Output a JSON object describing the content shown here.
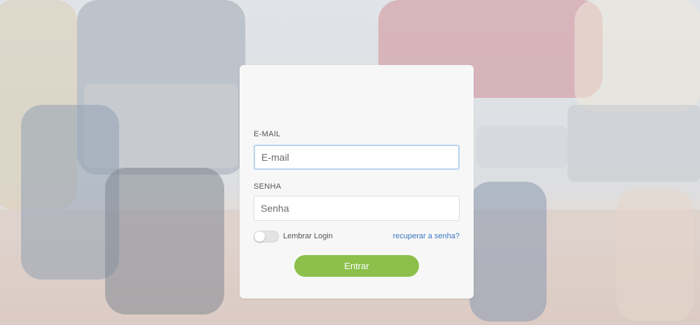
{
  "form": {
    "email_label": "E-MAIL",
    "email_placeholder": "E-mail",
    "email_value": "",
    "password_label": "SENHA",
    "password_placeholder": "Senha",
    "password_value": "",
    "remember_label": "Lembrar Login",
    "remember_checked": false,
    "recover_link": "recuperar a senha?",
    "submit_label": "Entrar"
  },
  "colors": {
    "button": "#8cc04a",
    "link": "#3b78c2",
    "card": "#f7f7f7"
  }
}
